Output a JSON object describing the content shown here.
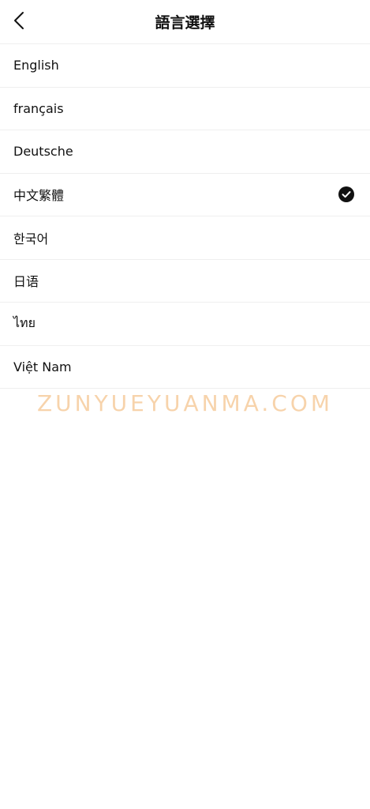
{
  "header": {
    "title": "語言選擇",
    "back_icon": "chevron-left-icon"
  },
  "languages": [
    {
      "label": "English",
      "selected": false
    },
    {
      "label": "français",
      "selected": false
    },
    {
      "label": "Deutsche",
      "selected": false
    },
    {
      "label": "中文繁體",
      "selected": true
    },
    {
      "label": "한국어",
      "selected": false
    },
    {
      "label": "日语",
      "selected": false
    },
    {
      "label": "ไทย",
      "selected": false
    },
    {
      "label": "Việt Nam",
      "selected": false
    }
  ],
  "selected_icon": "check-circle-icon",
  "watermark": "ZUNYUEYUANMA.COM",
  "colors": {
    "text": "#111111",
    "divider": "#efefef",
    "watermark": "#f7cfa3"
  }
}
